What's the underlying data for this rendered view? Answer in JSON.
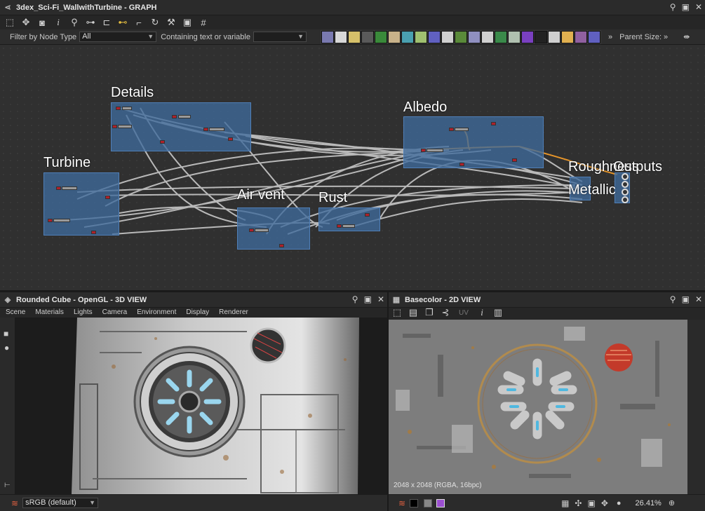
{
  "graph_panel": {
    "title": "3dex_Sci-Fi_WallwithTurbine - GRAPH",
    "filter_label": "Filter by Node Type",
    "filter_value": "All",
    "containing_label": "Containing text or variable",
    "parent_size_label": "Parent Size:",
    "toolbar_icons": [
      "fit-view-icon",
      "move-icon",
      "camera-icon",
      "info-icon",
      "search-icon",
      "connect-icon",
      "frame-icon",
      "link-icon",
      "pin-node-icon",
      "refresh-icon",
      "tools-icon",
      "export-icon",
      "crop-icon"
    ],
    "node_chips": [
      "#7a7ab0",
      "#d8d8d8",
      "#d6c06a",
      "#5a5a5a",
      "#3a8a3a",
      "#c8b28a",
      "#4aa0b0",
      "#a0c070",
      "#6060c0",
      "#d0d0d0",
      "#5a8a3a",
      "#9090c0",
      "#d0d0d0",
      "#3a8a4a",
      "#b0c0b0",
      "#7a40c0",
      "#222222",
      "#d0d0d0",
      "#e0b050",
      "#9060a0",
      "#6060c0"
    ],
    "frames": [
      {
        "label": "Details"
      },
      {
        "label": "Albedo"
      },
      {
        "label": "Turbine"
      },
      {
        "label": "Air vent"
      },
      {
        "label": "Rust"
      },
      {
        "label": "Roughness"
      },
      {
        "label": "Metallic"
      },
      {
        "label": "Outputs"
      }
    ]
  },
  "view3d_panel": {
    "title": "Rounded Cube - OpenGL - 3D VIEW",
    "menu": [
      "Scene",
      "Materials",
      "Lights",
      "Camera",
      "Environment",
      "Display",
      "Renderer"
    ],
    "colorspace": "sRGB (default)"
  },
  "view2d_panel": {
    "title": "Basecolor - 2D VIEW",
    "uv_label": "UV",
    "resolution_text": "2048 x 2048 (RGBA, 16bpc)",
    "zoom": "26.41%"
  },
  "colors": {
    "frame_fill": "#3f6a9b",
    "accent_wire": "#e8962a",
    "wire": "#c8c8c8",
    "node_port": "#b0202a"
  }
}
